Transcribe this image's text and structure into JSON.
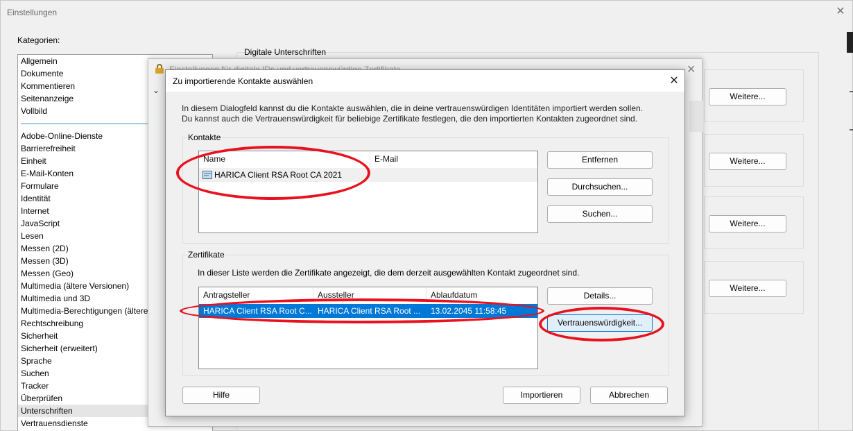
{
  "outer": {
    "title": "Einstellungen",
    "categories_label": "Kategorien:",
    "categories_group1": [
      "Allgemein",
      "Dokumente",
      "Kommentieren",
      "Seitenanzeige",
      "Vollbild"
    ],
    "categories_group2": [
      "Adobe-Online-Dienste",
      "Barrierefreiheit",
      "Einheit",
      "E-Mail-Konten",
      "Formulare",
      "Identität",
      "Internet",
      "JavaScript",
      "Lesen",
      "Messen (2D)",
      "Messen (3D)",
      "Messen (Geo)",
      "Multimedia (ältere Versionen)",
      "Multimedia und 3D",
      "Multimedia-Berechtigungen (ältere Versionen)",
      "Rechtschreibung",
      "Sicherheit",
      "Sicherheit (erweitert)",
      "Sprache",
      "Suchen",
      "Tracker",
      "Überprüfen",
      "Unterschriften",
      "Vertrauensdienste"
    ],
    "selected_category": "Unterschriften",
    "section_title": "Digitale Unterschriften",
    "more_button": "Weitere..."
  },
  "middle": {
    "title": "Einstellungen für digitale IDs und vertrauenswürdige Zertifikate"
  },
  "dialog": {
    "title": "Zu importierende Kontakte auswählen",
    "intro_line1": "In diesem Dialogfeld kannst du die Kontakte auswählen, die in deine vertrauenswürdigen Identitäten importiert werden sollen.",
    "intro_line2": "Du kannst auch die Vertrauenswürdigkeit für beliebige Zertifikate festlegen, die den importierten Kontakten zugeordnet sind.",
    "contacts": {
      "label": "Kontakte",
      "columns": [
        "Name",
        "E-Mail"
      ],
      "rows": [
        {
          "name": "HARICA Client RSA Root CA 2021",
          "email": ""
        }
      ],
      "buttons": {
        "remove": "Entfernen",
        "browse": "Durchsuchen...",
        "search": "Suchen..."
      }
    },
    "certificates": {
      "label": "Zertifikate",
      "description": "In dieser Liste werden die Zertifikate angezeigt, die dem derzeit ausgewählten Kontakt zugeordnet sind.",
      "columns": [
        "Antragsteller",
        "Aussteller",
        "Ablaufdatum"
      ],
      "rows": [
        {
          "subject": "HARICA Client RSA Root C...",
          "issuer": "HARICA Client RSA Root ...",
          "expiry": "13.02.2045 11:58:45"
        }
      ],
      "buttons": {
        "details": "Details...",
        "trust": "Vertrauenswürdigkeit..."
      }
    },
    "footer": {
      "help": "Hilfe",
      "import": "Importieren",
      "cancel": "Abbrechen"
    }
  },
  "colors": {
    "selection": "#0078d7",
    "annotation": "#e8121f"
  }
}
